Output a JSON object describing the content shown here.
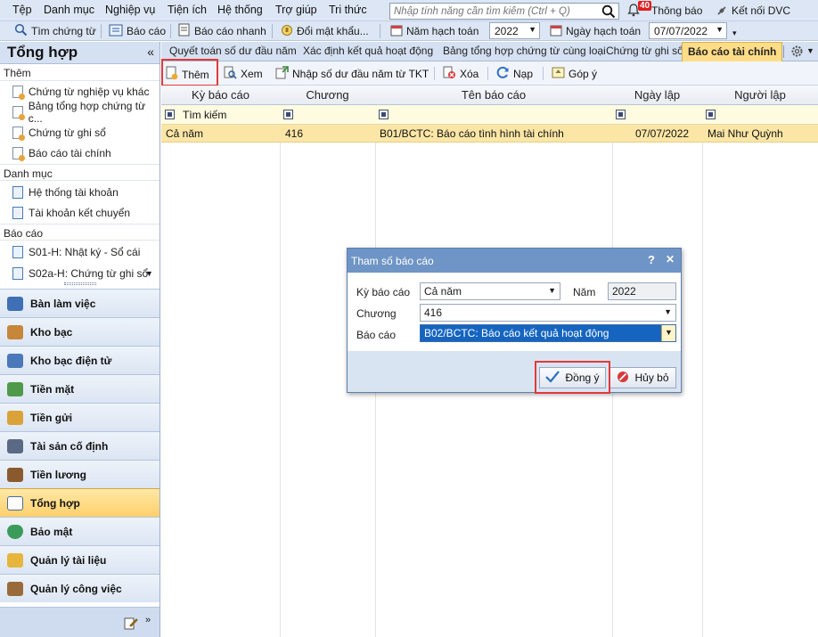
{
  "menu": {
    "items": [
      "Tệp",
      "Danh mục",
      "Nghiệp vụ",
      "Tiện ích",
      "Hệ thống",
      "Trợ giúp",
      "Tri thức"
    ],
    "search_placeholder": "Nhập tính năng cần tìm kiếm (Ctrl + Q)",
    "notification_count": "40",
    "notification_label": "Thông báo",
    "connect_label": "Kết nối DVC"
  },
  "toolbar": {
    "find_voucher": "Tìm chứng từ",
    "report": "Báo cáo",
    "quick_report": "Báo cáo nhanh",
    "change_password": "Đổi mật khẩu...",
    "fiscal_year_label": "Năm hạch toán",
    "fiscal_year_value": "2022",
    "posting_date_label": "Ngày hạch toán",
    "posting_date_value": "07/07/2022"
  },
  "sidebar": {
    "title": "Tổng hợp",
    "collapse": "«",
    "sections": {
      "add": "Thêm",
      "catalog": "Danh mục",
      "reports": "Báo cáo"
    },
    "add_items": [
      "Chứng từ nghiệp vụ khác",
      "Bảng tổng hợp chứng từ c...",
      "Chứng từ ghi sổ",
      "Báo cáo tài chính"
    ],
    "catalog_items": [
      "Hệ thống tài khoản",
      "Tài khoản kết chuyển"
    ],
    "report_items": [
      "S01-H: Nhật ký - Sổ cái",
      "S02a-H: Chứng từ ghi sổ"
    ],
    "nav": [
      "Bàn làm việc",
      "Kho bạc",
      "Kho bạc điện tử",
      "Tiền mặt",
      "Tiền gửi",
      "Tài sản cố định",
      "Tiền lương",
      "Tổng hợp",
      "Bảo mật",
      "Quản lý tài liệu",
      "Quản lý công việc"
    ],
    "active_nav": "Tổng hợp"
  },
  "tabs": {
    "items": [
      "Quyết toán số dư đầu năm",
      "Xác định kết quả hoạt động",
      "Bảng tổng hợp chứng từ cùng loại",
      "Chứng từ ghi sổ",
      "Báo cáo tài chính"
    ],
    "active": "Báo cáo tài chính"
  },
  "actions": {
    "add": "Thêm",
    "view": "Xem",
    "import_opening": "Nhập số dư đầu năm từ TKT",
    "delete": "Xóa",
    "reload": "Nạp",
    "feedback": "Góp ý"
  },
  "grid": {
    "columns": [
      "Kỳ báo cáo",
      "Chương",
      "Tên báo cáo",
      "Ngày lập",
      "Người lập"
    ],
    "filter_placeholder": "Tìm kiếm",
    "rows": [
      {
        "period": "Cả năm",
        "chapter": "416",
        "name": "B01/BCTC: Báo cáo tình hình tài chính",
        "date": "07/07/2022",
        "creator": "Mai Như Quỳnh"
      }
    ]
  },
  "dialog": {
    "title": "Tham số báo cáo",
    "help": "?",
    "close": "✕",
    "period_label": "Kỳ báo cáo",
    "period_value": "Cả năm",
    "year_label": "Năm",
    "year_value": "2022",
    "chapter_label": "Chương",
    "chapter_value": "416",
    "report_label": "Báo cáo",
    "report_value": "B02/BCTC: Báo cáo kết quả hoạt động",
    "ok_label": "Đồng ý",
    "cancel_label": "Hủy bỏ"
  },
  "colors": {
    "accent": "#6f95c6",
    "active_tab": "#ffdd88",
    "selected_row": "#fbe6a6",
    "highlight_border": "#e23a3a"
  }
}
